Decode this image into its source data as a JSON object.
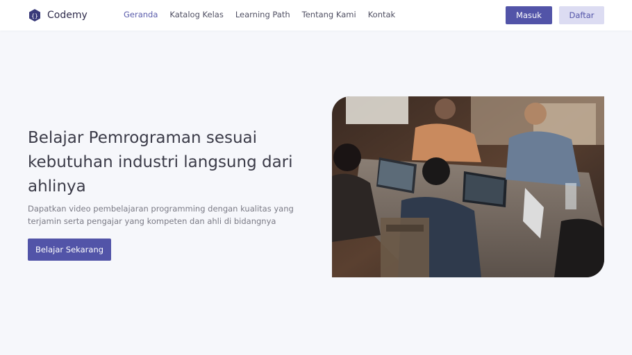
{
  "brand": {
    "name": "Codemy",
    "icon": "code-hexagon-icon",
    "accent_color": "#5254a8",
    "accent_light": "#dcdcf2"
  },
  "nav": {
    "links": [
      "Geranda",
      "Katalog Kelas",
      "Learning Path",
      "Tentang Kami",
      "Kontak"
    ]
  },
  "auth": {
    "login_label": "Masuk",
    "register_label": "Daftar"
  },
  "hero": {
    "title": "Belajar Pemrograman sesuai kebutuhan industri langsung dari ahlinya",
    "description": "Dapatkan video pembelajaran programming dengan kualitas yang terjamin serta pengajar yang kompeten dan ahli di bidangnya",
    "cta_label": "Belajar Sekarang",
    "image": "photo of people coding together at a table"
  }
}
